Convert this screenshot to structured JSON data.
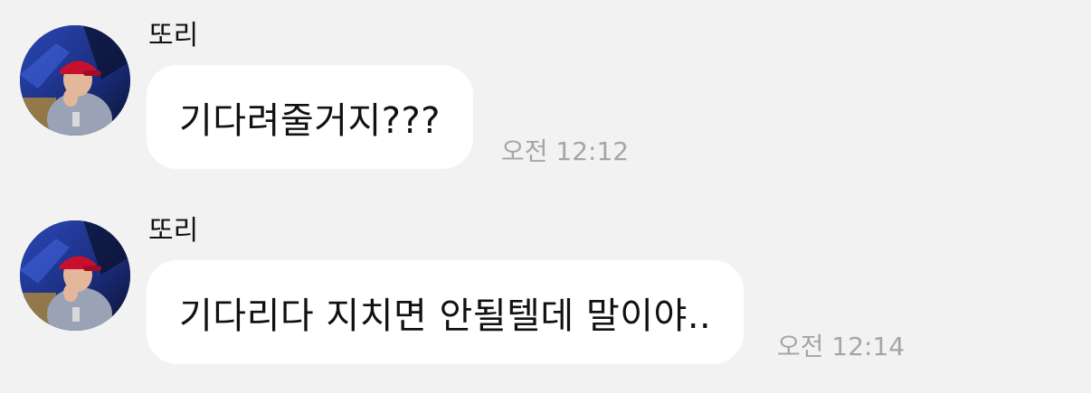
{
  "colors": {
    "background": "#f2f2f3",
    "bubble": "#ffffff",
    "text": "#111111",
    "timestamp": "#a5a5a9"
  },
  "messages": [
    {
      "sender": "또리",
      "avatar_icon": "profile-photo",
      "text": "기다려줄거지???",
      "time": "오전 12:12"
    },
    {
      "sender": "또리",
      "avatar_icon": "profile-photo",
      "text": "기다리다 지치면 안될텔데 말이야..",
      "time": "오전 12:14"
    }
  ]
}
